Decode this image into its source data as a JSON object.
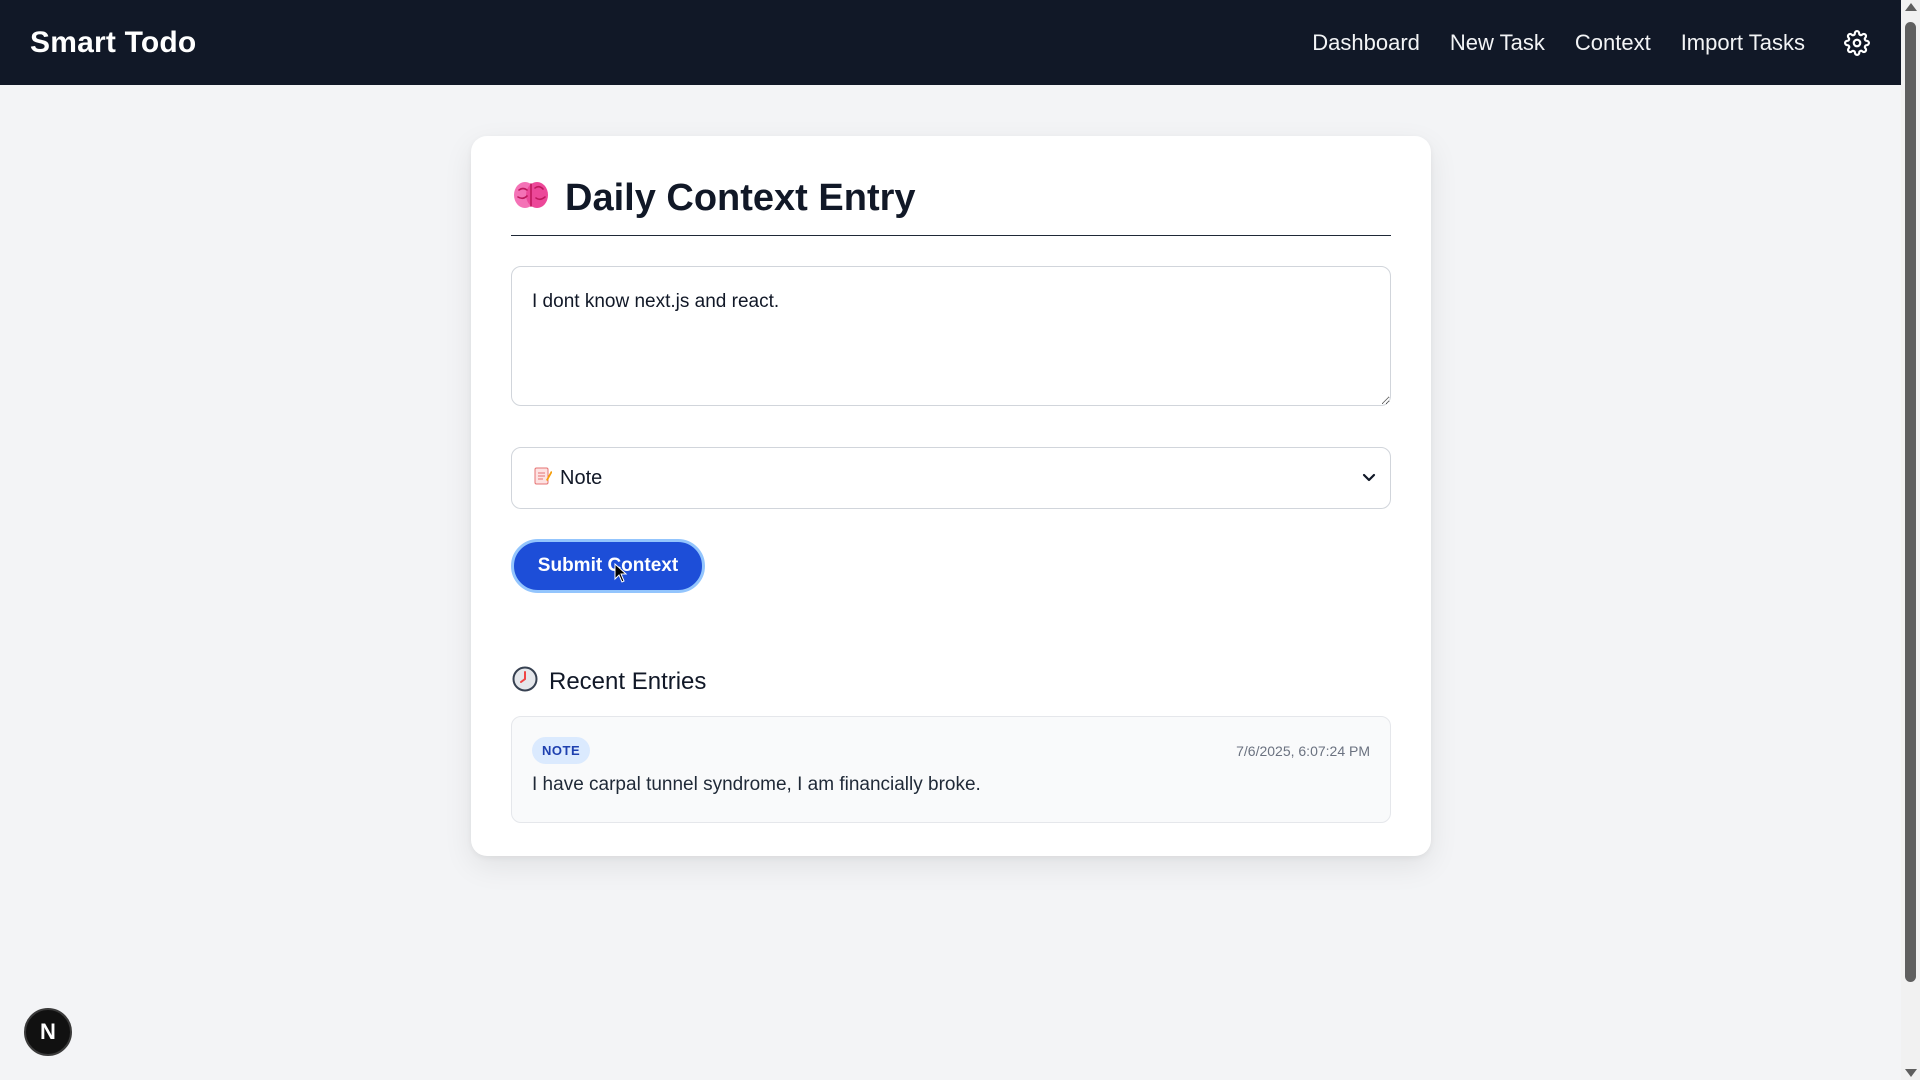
{
  "navbar": {
    "brand": "Smart Todo",
    "links": [
      {
        "label": "Dashboard"
      },
      {
        "label": "New Task"
      },
      {
        "label": "Context"
      },
      {
        "label": "Import Tasks"
      }
    ],
    "settings_icon": "gear-icon"
  },
  "main": {
    "title": "Daily Context Entry",
    "title_icon": "brain-icon",
    "context_input": {
      "value": "I dont know next.js and react."
    },
    "type_select": {
      "icon": "memo-icon",
      "selected": "Note"
    },
    "submit_label": "Submit Context",
    "recent": {
      "title": "Recent Entries",
      "icon": "clock-icon",
      "entries": [
        {
          "type": "NOTE",
          "timestamp": "7/6/2025, 6:07:24 PM",
          "text": "I have carpal tunnel syndrome, I am financially broke."
        }
      ]
    }
  },
  "dev_badge": {
    "label": "N"
  },
  "colors": {
    "navbar_bg": "#111827",
    "page_bg": "#f3f4f6",
    "primary": "#1d4ed8",
    "badge_bg": "#dbeafe",
    "badge_text": "#1e40af"
  }
}
